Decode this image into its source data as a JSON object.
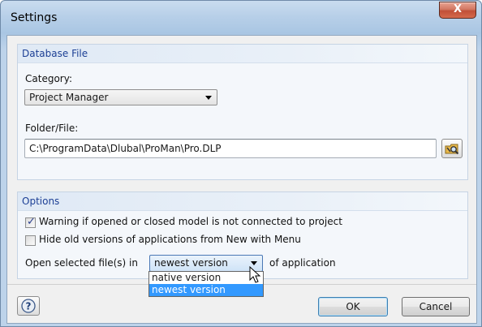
{
  "window": {
    "title": "Settings",
    "close_label": "X"
  },
  "database_file": {
    "header": "Database File",
    "category_label": "Category:",
    "category_value": "Project Manager",
    "folder_label": "Folder/File:",
    "folder_value": "C:\\ProgramData\\Dlubal\\ProMan\\Pro.DLP",
    "browse_icon": "folder-search-icon"
  },
  "options": {
    "header": "Options",
    "checkbox_warning": {
      "label": "Warning if opened or closed model is not connected to project",
      "checked": true
    },
    "checkbox_hide": {
      "label": "Hide old versions of applications from New with Menu",
      "checked": false
    },
    "open_label": "Open selected file(s) in",
    "open_value": "newest version",
    "open_suffix": "of application",
    "open_options": [
      "native version",
      "newest version"
    ],
    "open_selected_index": 1
  },
  "footer": {
    "help_icon": "help-icon",
    "ok_label": "OK",
    "cancel_label": "Cancel"
  },
  "colors": {
    "accent": "#1c3f95",
    "selection": "#3399ff",
    "close": "#c14f37"
  }
}
